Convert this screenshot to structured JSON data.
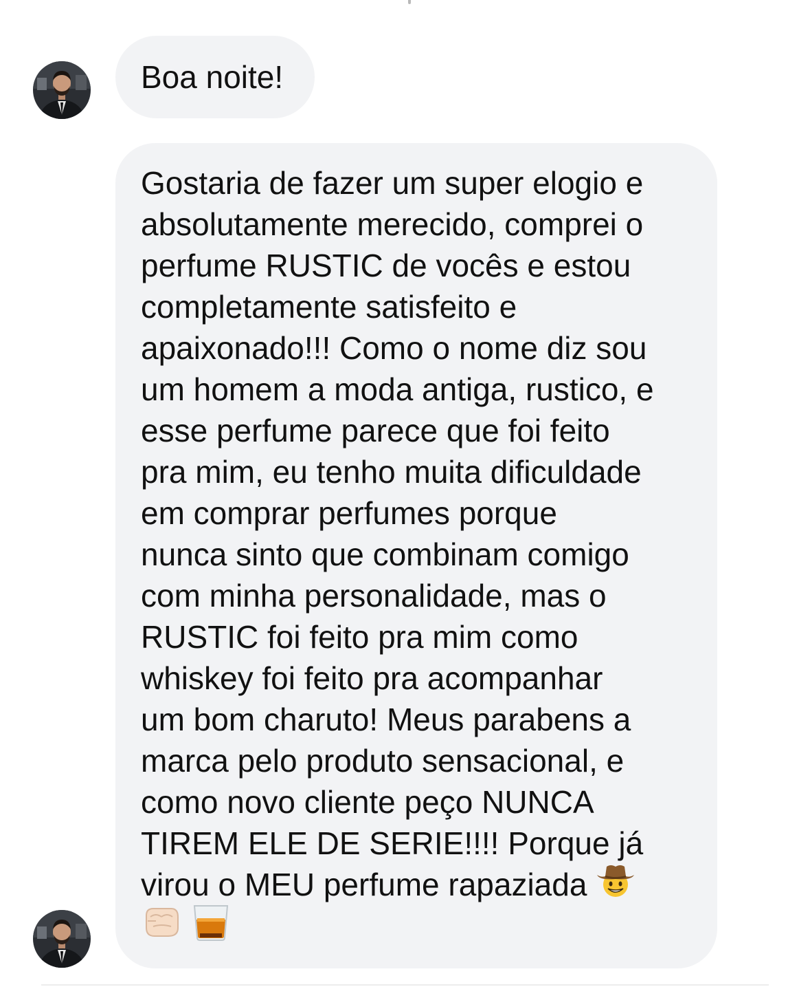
{
  "conversation": {
    "messages": [
      {
        "sender_avatar": "avatar",
        "lines": [
          "Boa noite!"
        ]
      },
      {
        "sender_avatar": "avatar",
        "lines": [
          "Gostaria de fazer um super elogio e",
          "absolutamente merecido, comprei o",
          "perfume RUSTIC de vocês e estou",
          "completamente satisfeito e",
          "apaixonado!!! Como o nome diz sou",
          "um homem a moda antiga, rustico, e",
          "esse perfume parece que foi feito",
          "pra mim, eu tenho muita dificuldade",
          "em comprar perfumes porque",
          "nunca sinto que combinam comigo",
          "com minha personalidade, mas o",
          "RUSTIC foi feito pra mim como",
          "whiskey foi feito pra acompanhar",
          "um bom charuto! Meus parabens a",
          "marca pelo produto sensacional, e",
          "como novo cliente peço NUNCA",
          "TIREM ELE DE SERIE!!!! Porque já",
          "virou o MEU perfume rapaziada"
        ],
        "emojis": [
          "cowboy-hat-face-emoji",
          "oncoming-fist-emoji",
          "tumbler-glass-emoji"
        ]
      }
    ]
  },
  "colors": {
    "bubble_bg": "#f2f3f5",
    "text": "#111111",
    "background": "#ffffff"
  }
}
